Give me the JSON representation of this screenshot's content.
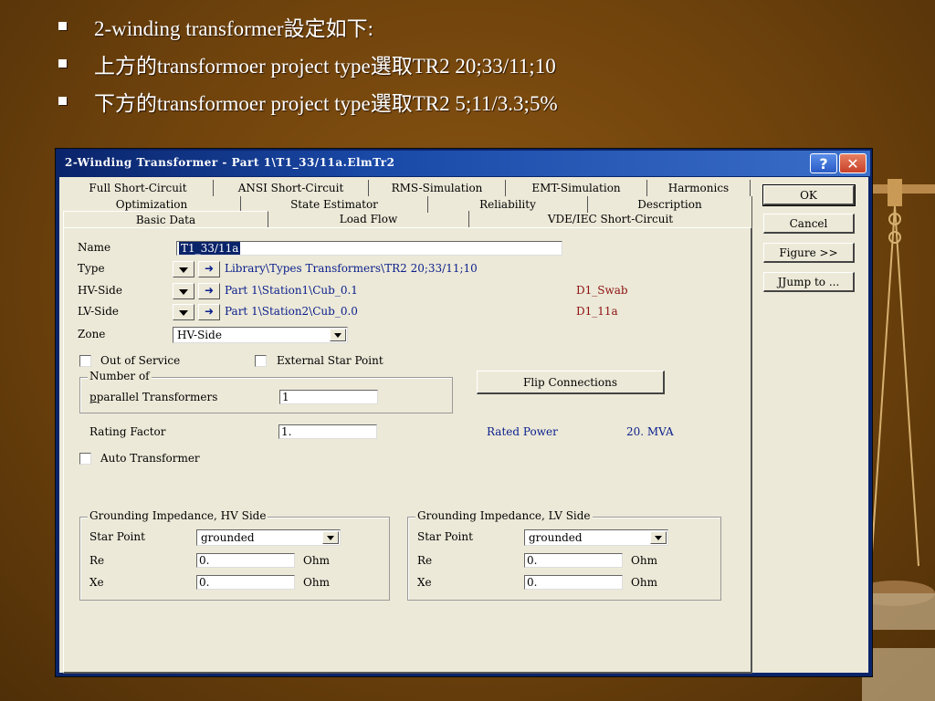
{
  "bullets": [
    "2-winding transformer設定如下:",
    "上方的transformoer project type選取TR2 20;33/11;10",
    "下方的transformoer project type選取TR2 5;11/3.3;5%"
  ],
  "dialog": {
    "title": "2-Winding Transformer - Part 1\\T1_33/11a.ElmTr2",
    "help_label": "?",
    "close_label": "✕",
    "tabs_row1": [
      "Full Short-Circuit",
      "ANSI Short-Circuit",
      "RMS-Simulation",
      "EMT-Simulation",
      "Harmonics"
    ],
    "tabs_row2": [
      "Optimization",
      "State Estimator",
      "Reliability",
      "Description"
    ],
    "tabs_row3": [
      "Basic Data",
      "Load Flow",
      "VDE/IEC Short-Circuit"
    ],
    "active_tab": "Basic Data",
    "buttons": {
      "ok": "OK",
      "cancel": "Cancel",
      "figure": "Figure >>",
      "jump": "Jump to ..."
    },
    "fields": {
      "name_label": "Name",
      "name_value": "T1_33/11a",
      "type_label": "Type",
      "type_value": "Library\\Types Transformers\\TR2 20;33/11;10",
      "hv_label": "HV-Side",
      "hv_value": "Part 1\\Station1\\Cub_0.1",
      "hv_node": "D1_Swab",
      "lv_label": "LV-Side",
      "lv_value": "Part 1\\Station2\\Cub_0.0",
      "lv_node": "D1_11a",
      "zone_label": "Zone",
      "zone_value": "HV-Side",
      "out_of_service": "Out of Service",
      "external_star": "External Star Point",
      "number_of": "Number of",
      "parallel_label": "parallel Transformers",
      "parallel_value": "1",
      "flip": "Flip Connections",
      "rating_label": "Rating Factor",
      "rating_value": "1.",
      "rated_power_label": "Rated Power",
      "rated_power_value": "20. MVA",
      "auto_transformer": "Auto Transformer"
    },
    "grounding_hv": {
      "title": "Grounding Impedance, HV Side",
      "star_label": "Star Point",
      "star_value": "grounded",
      "re_label": "Re",
      "re_value": "0.",
      "xe_label": "Xe",
      "xe_value": "0.",
      "unit": "Ohm"
    },
    "grounding_lv": {
      "title": "Grounding Impedance, LV Side",
      "star_label": "Star Point",
      "star_value": "grounded",
      "re_label": "Re",
      "re_value": "0.",
      "xe_label": "Xe",
      "xe_value": "0.",
      "unit": "Ohm"
    }
  },
  "colors": {
    "background": "#6e420c",
    "titlebar": "#0a246a",
    "dialog_face": "#ece9d8",
    "link_blue": "#0a1e8c",
    "node_red": "#8c1010"
  }
}
